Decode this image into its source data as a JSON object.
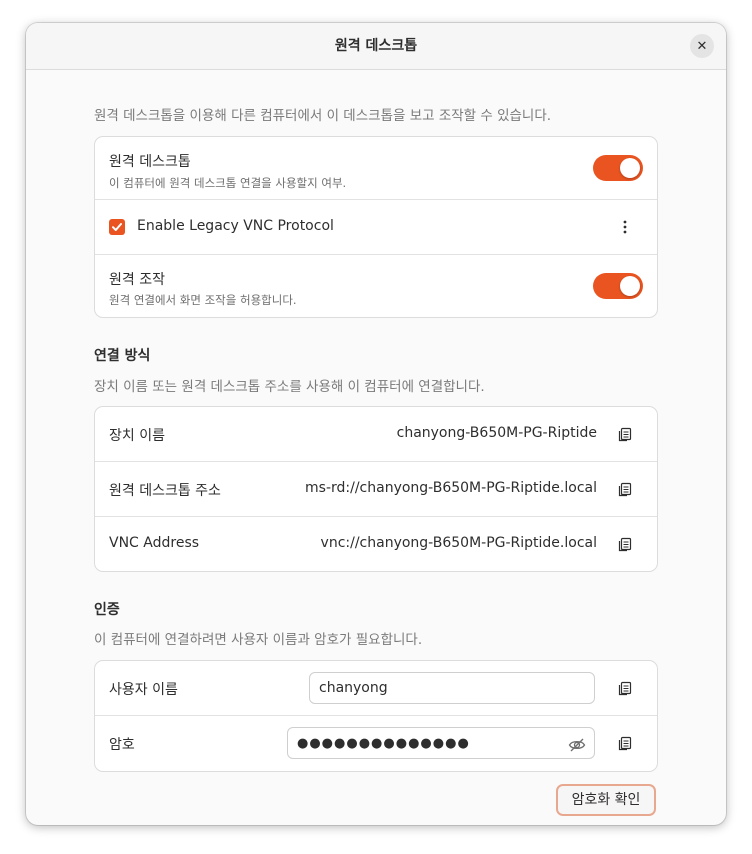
{
  "window": {
    "title": "원격 데스크톱",
    "close_label": "✕"
  },
  "intro_text": "원격 데스크톱을 이용해 다른 컴퓨터에서 이 데스크톱을 보고 조작할 수 있습니다.",
  "remote_card": {
    "remote_desktop": {
      "title": "원격 데스크톱",
      "subtitle": "이 컴퓨터에 원격 데스크톱 연결을 사용할지 여부.",
      "enabled": true
    },
    "legacy_vnc": {
      "label": "Enable Legacy VNC Protocol",
      "checked": true
    },
    "remote_control": {
      "title": "원격 조작",
      "subtitle": "원격 연결에서 화면 조작을 허용합니다.",
      "enabled": true
    }
  },
  "connection": {
    "title": "연결 방식",
    "description": "장치 이름 또는 원격 데스크톱 주소를 사용해 이 컴퓨터에 연결합니다.",
    "rows": [
      {
        "label": "장치 이름",
        "value": "chanyong-B650M-PG-Riptide"
      },
      {
        "label": "원격 데스크톱 주소",
        "value": "ms-rd://chanyong-B650M-PG-Riptide.local"
      },
      {
        "label": "VNC Address",
        "value": "vnc://chanyong-B650M-PG-Riptide.local"
      }
    ]
  },
  "auth": {
    "title": "인증",
    "description": "이 컴퓨터에 연결하려면 사용자 이름과 암호가 필요합니다.",
    "username_label": "사용자 이름",
    "username_value": "chanyong",
    "password_label": "암호",
    "password_value": "●●●●●●●●●●●●●●"
  },
  "verify_button": "암호화 확인",
  "colors": {
    "accent": "#e95420",
    "background": "#fafafa",
    "card": "#ffffff"
  }
}
